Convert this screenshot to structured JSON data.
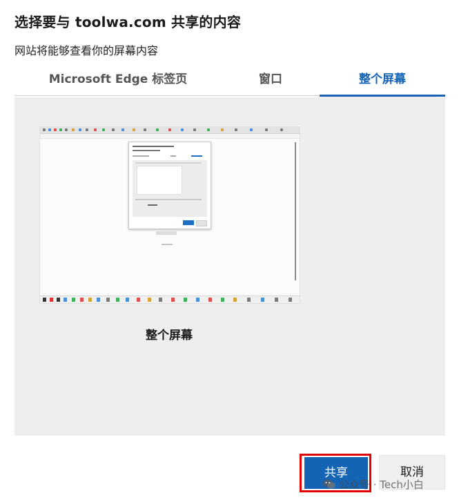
{
  "dialog": {
    "title": "选择要与 toolwa.com 共享的内容",
    "subtitle": "网站将能够查看你的屏幕内容"
  },
  "tabs": [
    {
      "label": "Microsoft Edge 标签页",
      "selected": false
    },
    {
      "label": "窗口",
      "selected": false
    },
    {
      "label": "整个屏幕",
      "selected": true
    }
  ],
  "screen_option": {
    "caption": "整个屏幕",
    "thumbnail_icon": "screen-thumbnail"
  },
  "buttons": {
    "share_label": "共享",
    "cancel_label": "取消"
  },
  "watermark": {
    "text": "公众号 · Tech小白",
    "icon": "wechat-icon"
  },
  "colors": {
    "accent": "#1463b4",
    "highlight_border": "#e00000",
    "panel_bg": "#eeeeee"
  }
}
